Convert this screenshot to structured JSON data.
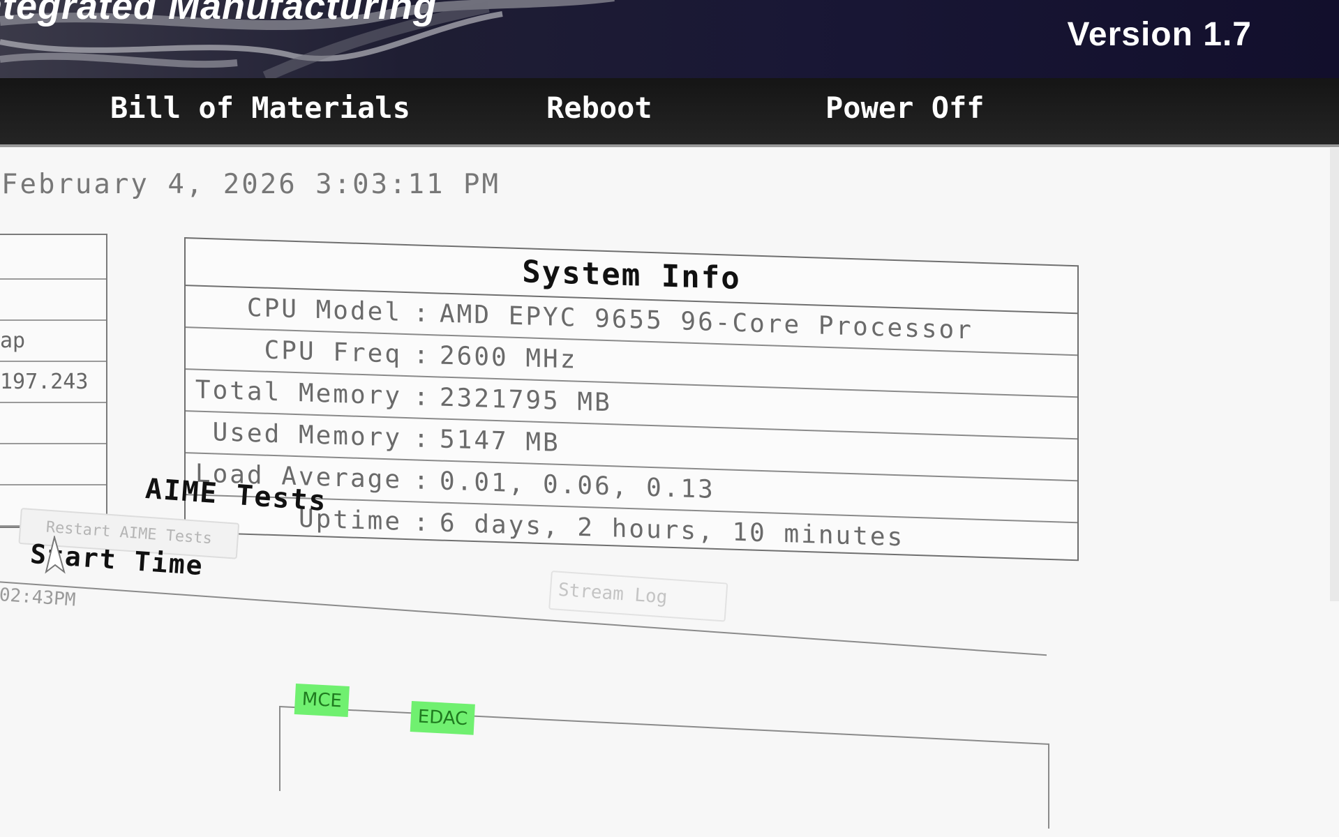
{
  "header": {
    "app_title": "ntegrated Manufacturing",
    "version": "Version 1.7"
  },
  "nav": {
    "bill_of_materials": "Bill of Materials",
    "reboot": "Reboot",
    "power_off": "Power Off"
  },
  "datetime": "February 4, 2026 3:03:11 PM",
  "left_panel": {
    "rows": [
      "",
      "",
      "ap",
      "197.243",
      "",
      "",
      ""
    ]
  },
  "system_info": {
    "title": "System Info",
    "rows": [
      {
        "label": "CPU Model",
        "value": "AMD EPYC 9655 96-Core Processor"
      },
      {
        "label": "CPU Freq",
        "value": "2600 MHz"
      },
      {
        "label": "Total Memory",
        "value": "2321795 MB"
      },
      {
        "label": "Used Memory",
        "value": "5147 MB"
      },
      {
        "label": "Load Average",
        "value": "0.01, 0.06, 0.13"
      },
      {
        "label": "Uptime",
        "value": "6 days, 2 hours, 10 minutes"
      }
    ]
  },
  "aime": {
    "title": "AIME Tests",
    "restart_label": "Restart AIME Tests",
    "badges": [
      "MCE",
      "EDAC"
    ],
    "stream_log": "Stream Log",
    "start_time_header": "Start Time",
    "start_time_value": "02:43PM"
  },
  "colors": {
    "badge_bg": "#70f070",
    "badge_text": "#1f7a1f",
    "navbar_bg": "#1c1c1c",
    "banner_bg": "#1f1e33"
  }
}
